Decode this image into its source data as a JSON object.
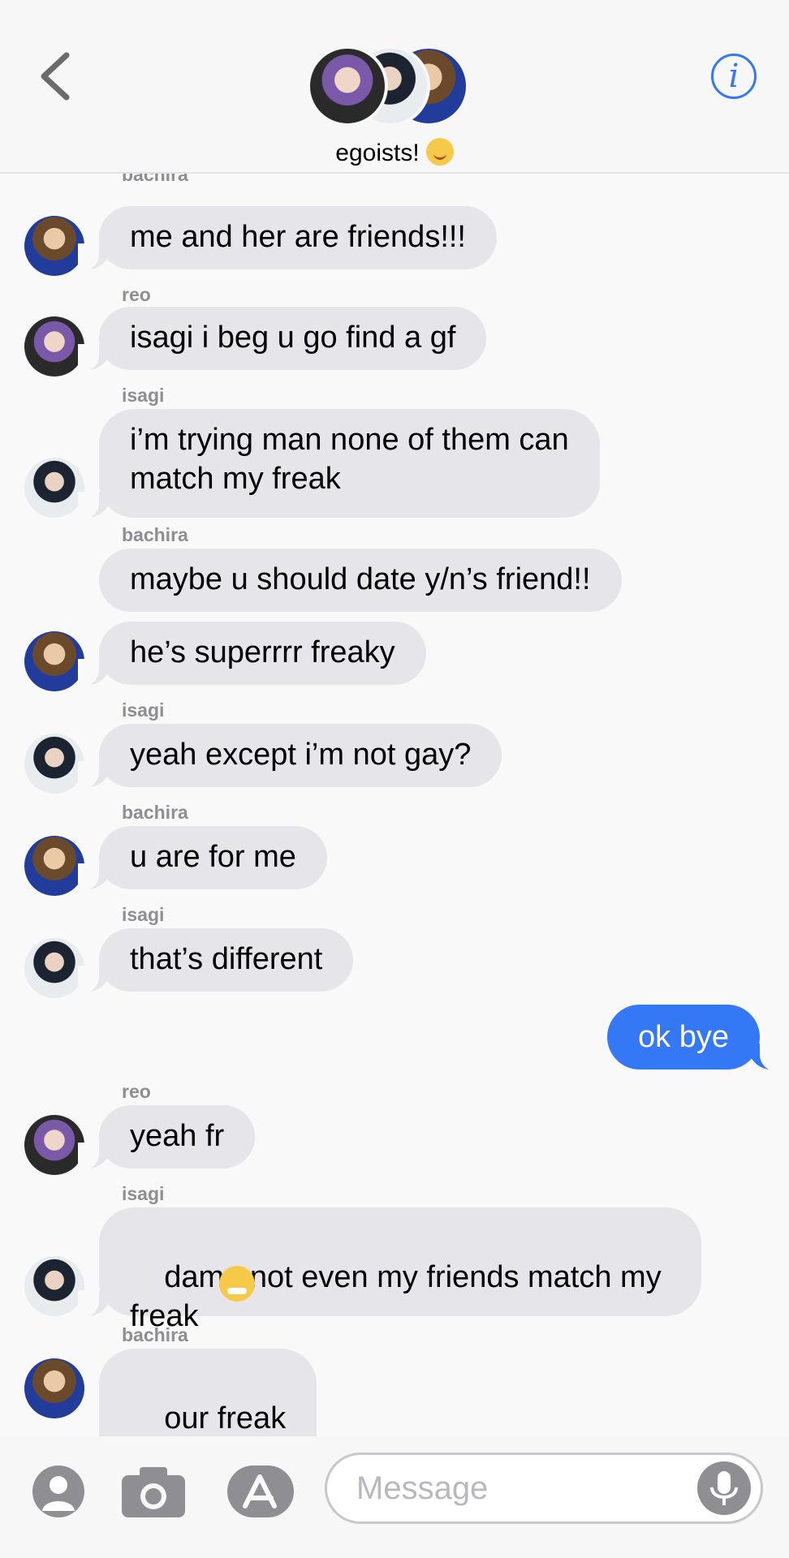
{
  "header": {
    "group_name": "egoists!",
    "info_label": "i"
  },
  "messages": [
    {
      "sender": "bachira",
      "text": "me and her are friends!!!"
    },
    {
      "sender": "reo",
      "text": "isagi i beg u go find a gf"
    },
    {
      "sender": "isagi",
      "text": "i’m trying man none of them can\nmatch my freak"
    },
    {
      "sender": "bachira",
      "text": "maybe u should date y/n’s friend!!"
    },
    {
      "text": "he’s superrrr freaky"
    },
    {
      "sender": "isagi",
      "text": "yeah except i’m not gay?"
    },
    {
      "sender": "bachira",
      "text": "u are for me"
    },
    {
      "sender": "isagi",
      "text": "that’s different"
    },
    {
      "outgoing": true,
      "text": "ok bye"
    },
    {
      "sender": "reo",
      "text": "yeah fr"
    },
    {
      "sender": "isagi",
      "text": "damn not even my friends match my\nfreak"
    },
    {
      "sender": "bachira",
      "text": "our freak"
    }
  ],
  "composer": {
    "placeholder": "Message"
  },
  "colors": {
    "accent": "#3478f6",
    "incoming_bubble": "#e5e5ea"
  },
  "icons": [
    "back-chevron-icon",
    "info-icon",
    "contacts-icon",
    "camera-icon",
    "app-store-icon",
    "microphone-icon",
    "tired-face-emoji",
    "red-heart-emoji",
    "smiling-face-emoji"
  ]
}
